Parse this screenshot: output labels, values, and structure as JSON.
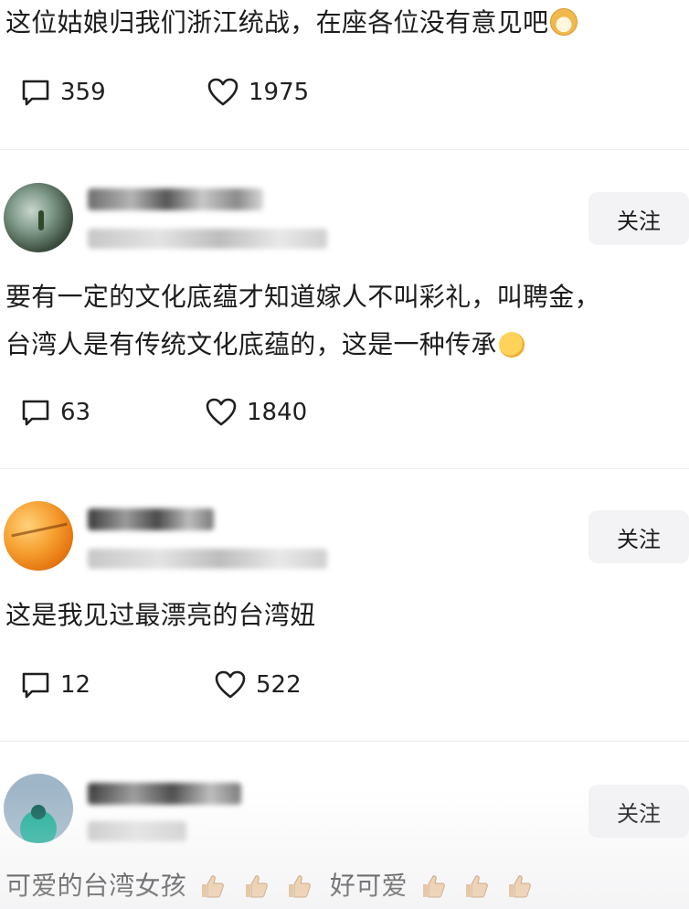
{
  "comments": [
    {
      "text_lines": [
        "这位姑娘归我们浙江统战，在座各位没有意见吧"
      ],
      "reply_count": "359",
      "like_count": "1975"
    },
    {
      "follow_label": "关注",
      "text_lines": [
        "要有一定的文化底蕴才知道嫁人不叫彩礼，叫聘金，",
        "台湾人是有传统文化底蕴的，这是一种传承"
      ],
      "reply_count": "63",
      "like_count": "1840"
    },
    {
      "follow_label": "关注",
      "text_lines": [
        "这是我见过最漂亮的台湾妞"
      ],
      "reply_count": "12",
      "like_count": "522"
    },
    {
      "follow_label": "关注",
      "text_a": "可爱的台湾女孩",
      "text_b": "好可爱"
    }
  ],
  "icons": {
    "reply": "speech-bubble-icon",
    "like": "heart-outline-icon",
    "emoji_1": "dog-face-emoji",
    "emoji_2": "thinking-face-emoji",
    "emoji_3": "thumbs-up-emoji"
  },
  "colors": {
    "follow_bg": "#f3f3f5",
    "divider": "#efefef",
    "text": "#1c1c1c"
  }
}
